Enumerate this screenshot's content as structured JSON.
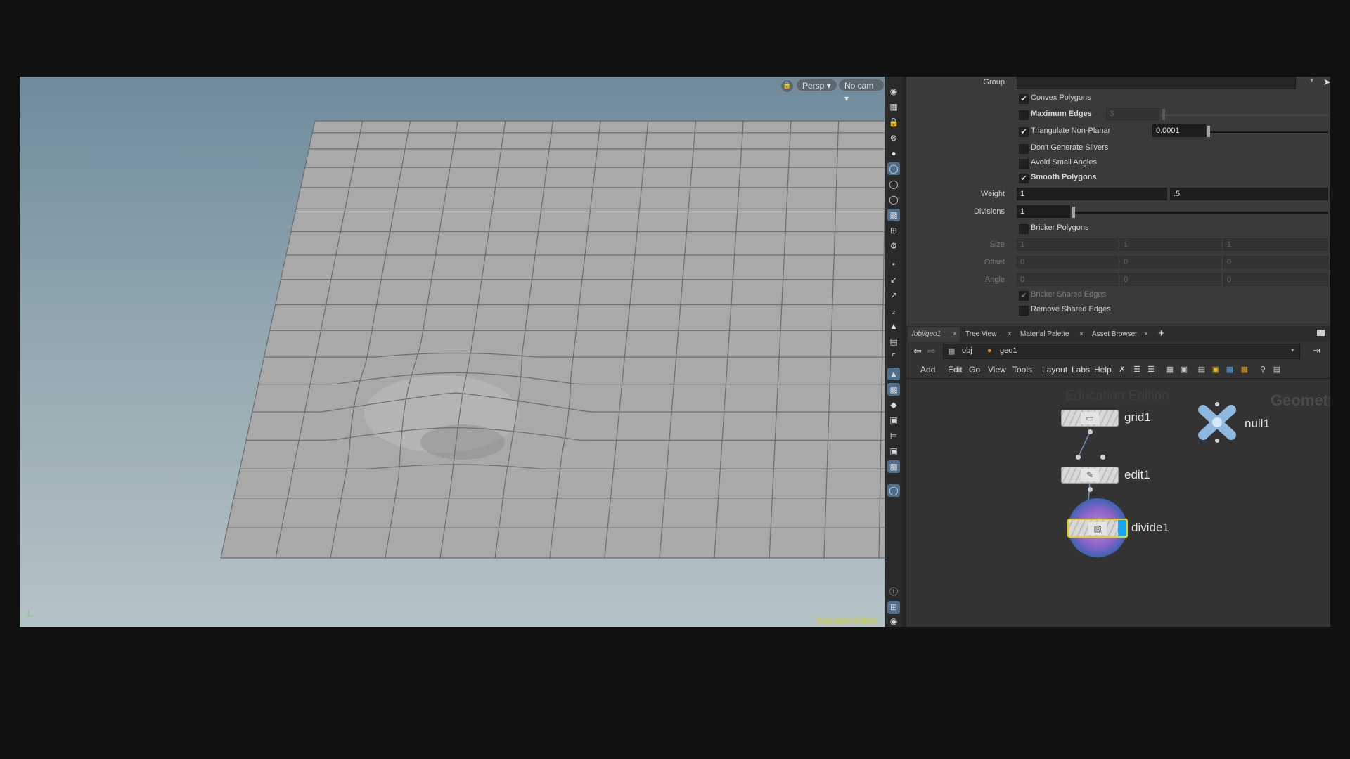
{
  "viewport": {
    "camera_menu": "Persp",
    "cam_menu": "No cam",
    "lock_icon": "lock-icon",
    "watermark": "Education Edition"
  },
  "params": {
    "group_label": "Group",
    "convex": {
      "label": "Convex Polygons",
      "checked": true
    },
    "max_edges": {
      "label": "Maximum Edges",
      "checked": false,
      "value": "3"
    },
    "triangulate": {
      "label": "Triangulate Non-Planar",
      "checked": true,
      "value": "0.0001"
    },
    "slivers": {
      "label": "Don't Generate Slivers",
      "checked": false
    },
    "small_angles": {
      "label": "Avoid Small Angles",
      "checked": false
    },
    "smooth": {
      "label": "Smooth Polygons",
      "checked": true
    },
    "weight": {
      "label": "Weight",
      "value1": "1",
      "value2": ".5"
    },
    "divisions": {
      "label": "Divisions",
      "value": "1"
    },
    "bricker": {
      "label": "Bricker Polygons",
      "checked": false
    },
    "size": {
      "label": "Size",
      "values": [
        "1",
        "1",
        "1"
      ]
    },
    "offset": {
      "label": "Offset",
      "values": [
        "0",
        "0",
        "0"
      ]
    },
    "angle": {
      "label": "Angle",
      "values": [
        "0",
        "0",
        "0"
      ]
    },
    "bricker_shared": {
      "label": "Bricker Shared Edges",
      "checked": true
    },
    "remove_shared": {
      "label": "Remove Shared Edges",
      "checked": false
    }
  },
  "tabs": [
    {
      "label": "/obj/geo1",
      "active": true
    },
    {
      "label": "Tree View",
      "active": false
    },
    {
      "label": "Material Palette",
      "active": false
    },
    {
      "label": "Asset Browser",
      "active": false
    }
  ],
  "path": {
    "level1": "obj",
    "level2": "geo1"
  },
  "menus": [
    "Add",
    "Edit",
    "Go",
    "View",
    "Tools",
    "Layout",
    "Labs",
    "Help"
  ],
  "network": {
    "watermark": "Education Edition",
    "context_label": "Geometry",
    "nodes": {
      "grid": "grid1",
      "edit": "edit1",
      "divide": "divide1",
      "null": "null1"
    }
  }
}
